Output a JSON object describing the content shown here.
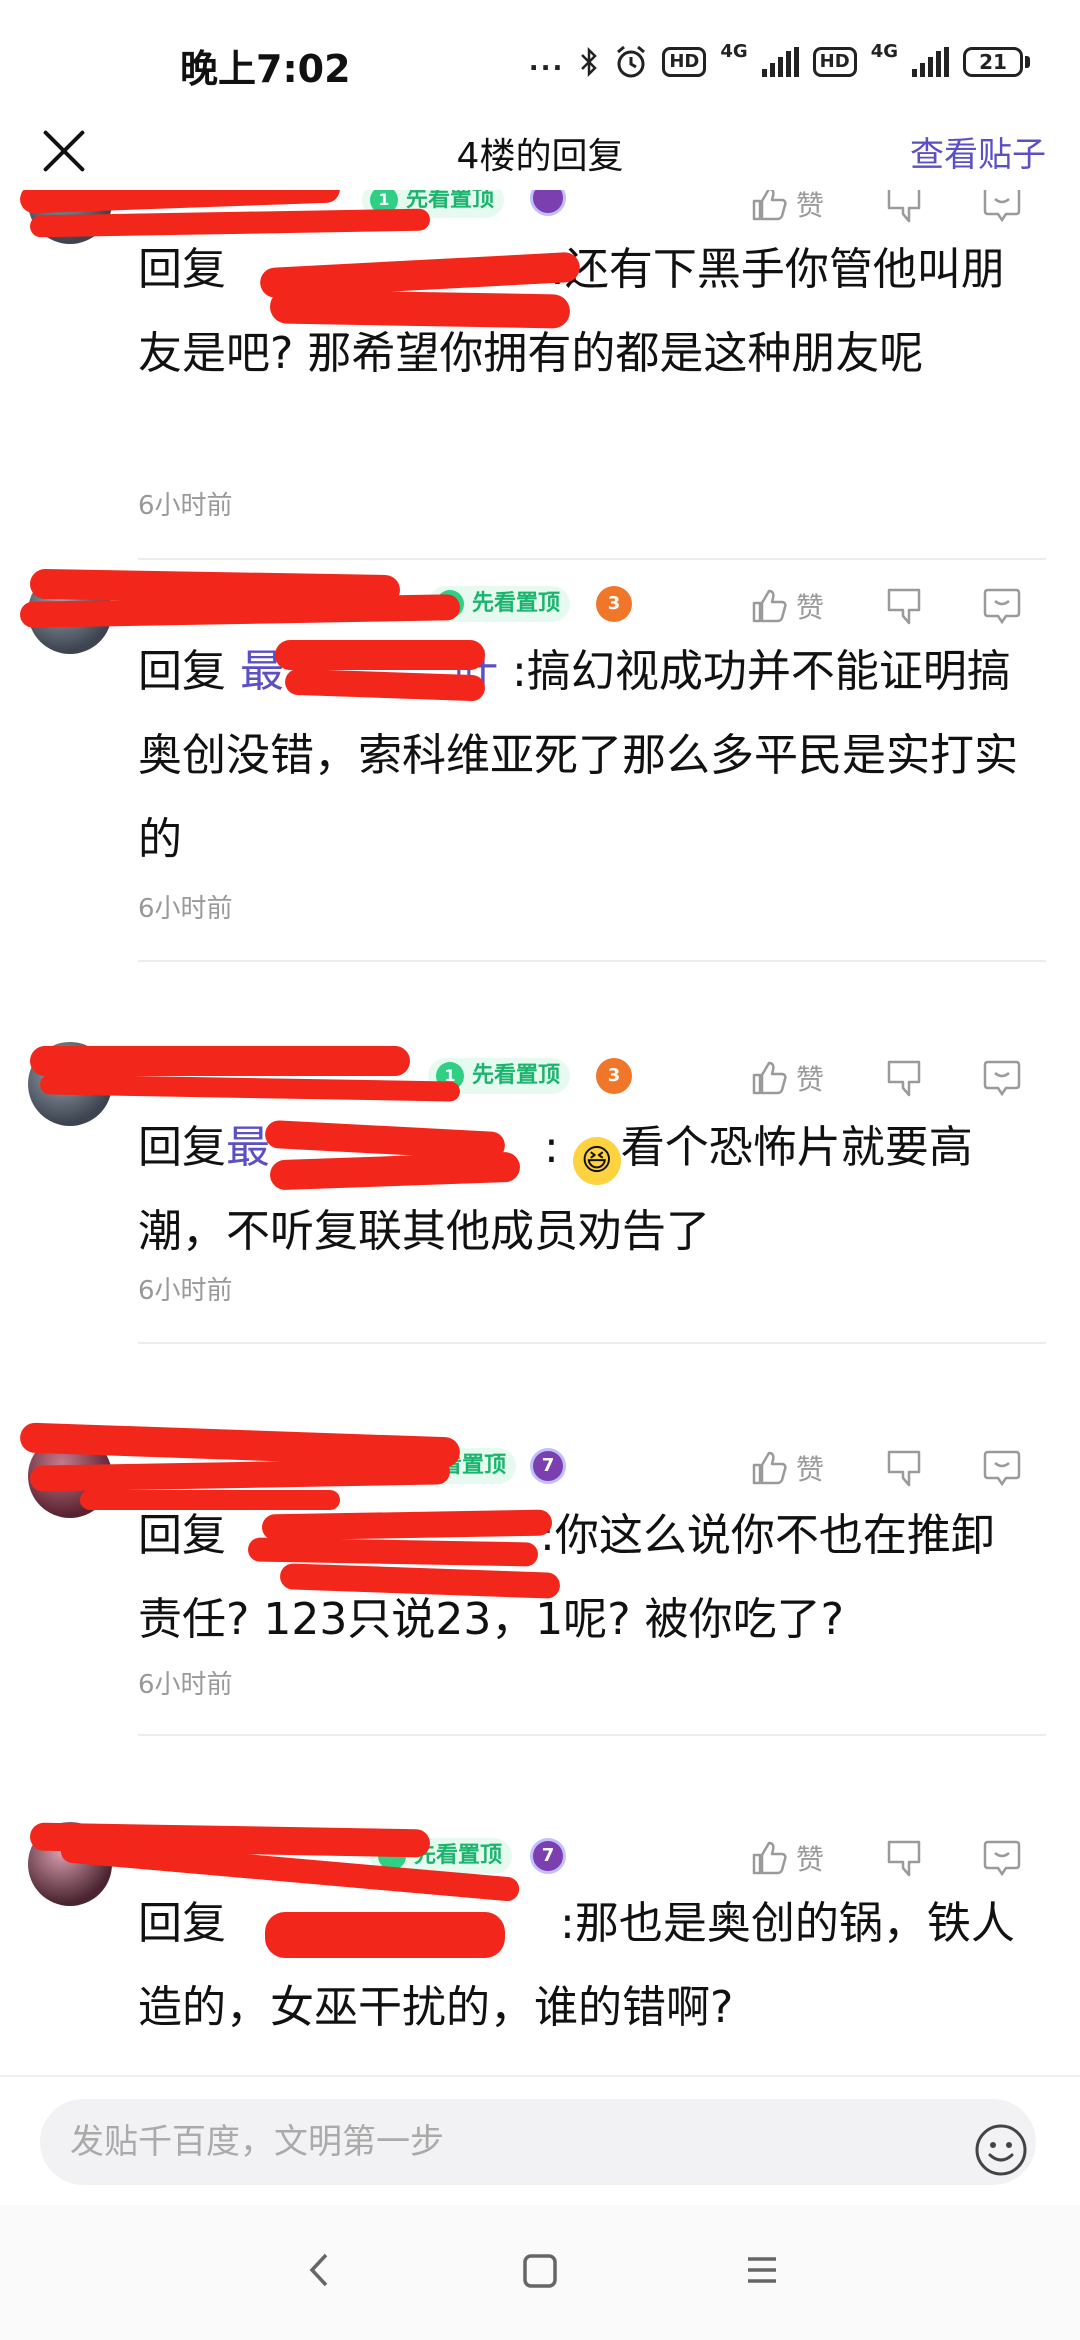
{
  "status_bar": {
    "time": "晚上7:02",
    "dots": "...",
    "bluetooth": "bluetooth-icon",
    "alarm": "alarm-icon",
    "hd1": "HD",
    "net1": "4G",
    "hd2": "HD",
    "net2": "4G",
    "battery": "21"
  },
  "nav": {
    "title": "4楼的回复",
    "view_post": "查看贴子"
  },
  "comments": [
    {
      "username": "",
      "badge_top": "先看置顶",
      "badge_level": "1",
      "like_label": "赞",
      "reply_prefix": "回复",
      "mention": "",
      "text": ":还有下黑手你管他叫朋友是吧? 那希望你拥有的都是这种朋友呢",
      "time": "6小时前"
    },
    {
      "username": "",
      "badge_top": "先看置顶",
      "badge_level": "1",
      "user_level": "3",
      "like_label": "赞",
      "reply_prefix": "回复",
      "mention": "最",
      "mention_tail": "叶",
      "text": ":搞幻视成功并不能证明搞奥创没错，索科维亚死了那么多平民是实打实的",
      "time": "6小时前"
    },
    {
      "username": "",
      "badge_top": "先看置顶",
      "badge_level": "1",
      "user_level": "3",
      "like_label": "赞",
      "reply_prefix": "回复",
      "mention": "最",
      "text": "看个恐怖片就要高潮，不听复联其他成员劝告了",
      "time": "6小时前"
    },
    {
      "username": "",
      "badge_top": "看置顶",
      "user_level": "7",
      "like_label": "赞",
      "reply_prefix": "回复",
      "mention": "",
      "text": ":你这么说你不也在推卸责任? 123只说23，1呢? 被你吃了?",
      "time": "6小时前"
    },
    {
      "username": "",
      "badge_top": "先看置顶",
      "user_level": "7",
      "like_label": "赞",
      "reply_prefix": "回复",
      "mention": "",
      "text": ":那也是奥创的锅，铁人造的，女巫干扰的，谁的错啊?",
      "time": ""
    }
  ],
  "input": {
    "placeholder": "发贴千百度，文明第一步"
  },
  "colors": {
    "accent": "#5b4fc4",
    "badge_green": "#1bb46f",
    "redaction": "#f2261a"
  }
}
